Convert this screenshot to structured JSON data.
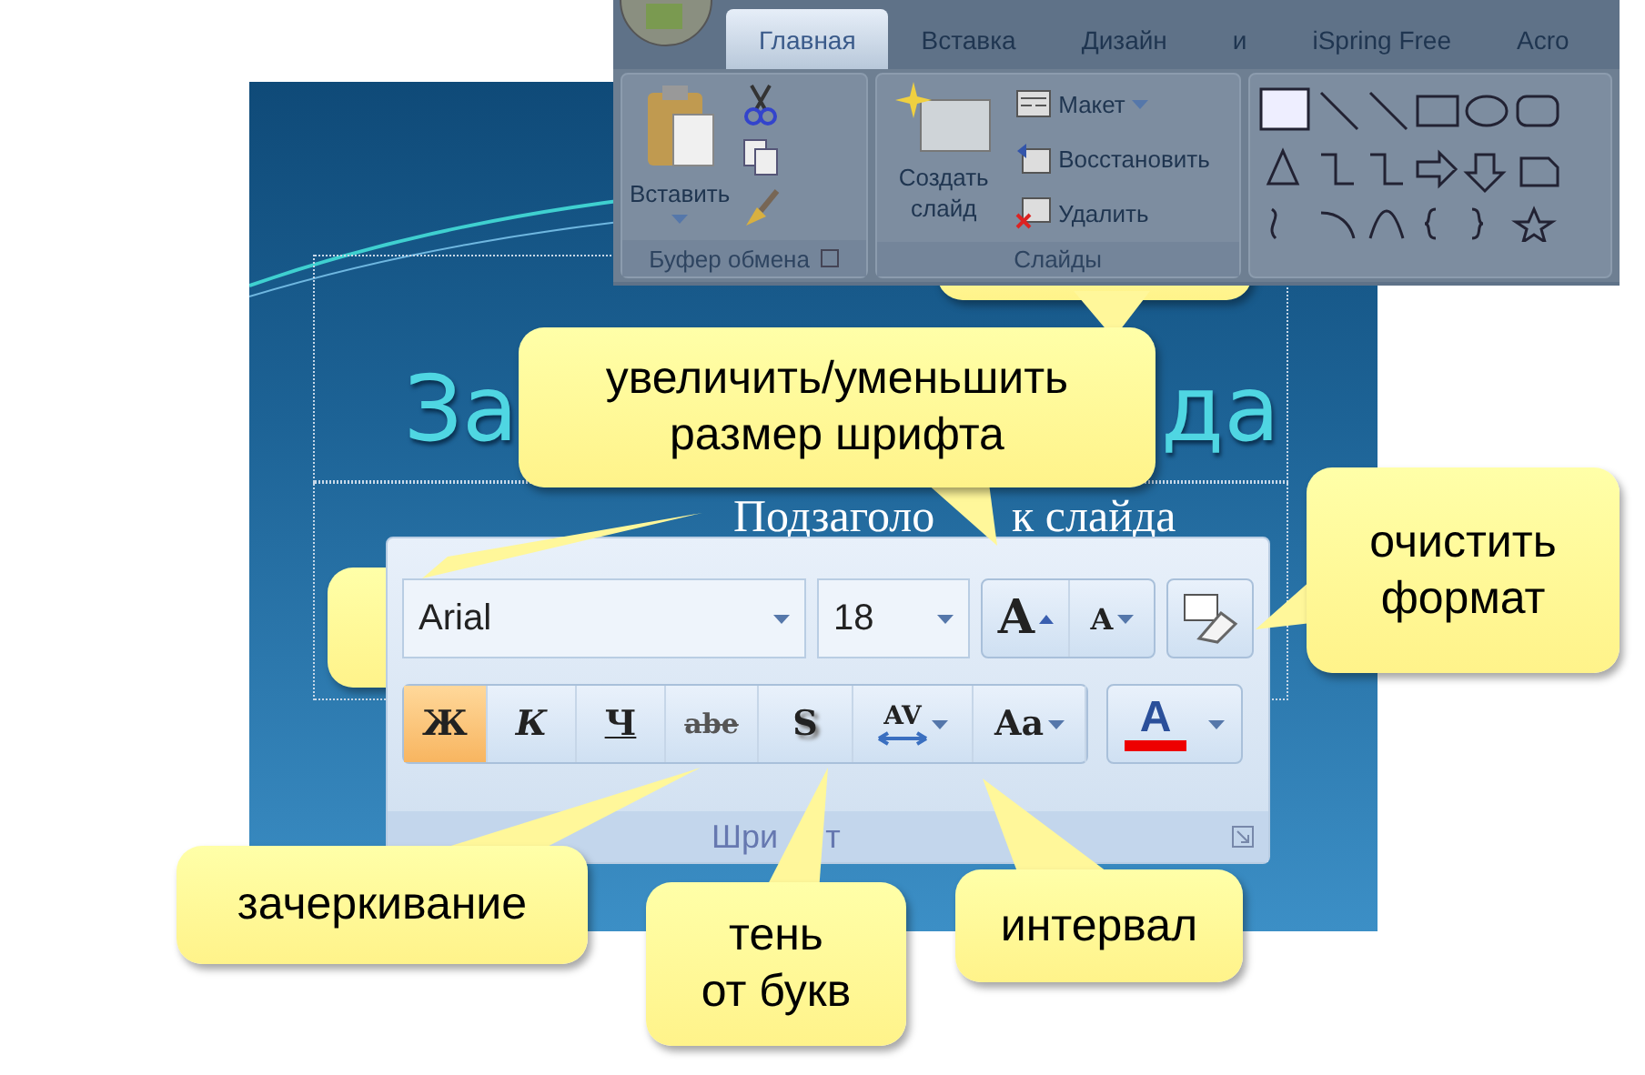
{
  "ribbon": {
    "tabs": [
      {
        "label": "Главная",
        "selected": true
      },
      {
        "label": "Вставка",
        "selected": false
      },
      {
        "label": "Дизайн",
        "selected": false
      },
      {
        "label": "и",
        "selected": false
      },
      {
        "label": "iSpring Free",
        "selected": false
      },
      {
        "label": "Acro",
        "selected": false
      }
    ],
    "clipboard": {
      "paste": "Вставить",
      "label": "Буфер обмена"
    },
    "slides": {
      "new_slide": "Создать слайд",
      "layout": "Макет",
      "reset": "Восстановить",
      "delete": "Удалить",
      "label": "Слайды"
    }
  },
  "slide": {
    "title_parts": [
      "За",
      "да"
    ],
    "subtitle_parts": [
      "Подзаголо",
      "к слайда"
    ]
  },
  "font_panel": {
    "font": "Arial",
    "size": "18",
    "grow": "A",
    "shrink": "A",
    "format_buttons": [
      {
        "kind": "bold",
        "label": "Ж",
        "selected": true
      },
      {
        "kind": "italic",
        "label": "К",
        "selected": false
      },
      {
        "kind": "underline",
        "label": "Ч",
        "selected": false
      },
      {
        "kind": "strike",
        "label": "abe",
        "selected": false
      },
      {
        "kind": "shadow",
        "label": "S",
        "selected": false
      },
      {
        "kind": "spacing",
        "label": "AV",
        "selected": false
      },
      {
        "kind": "case",
        "label": "Aa",
        "selected": false
      },
      {
        "kind": "color",
        "label": "A",
        "selected": false
      }
    ],
    "group_label_parts": [
      "Шри",
      "т"
    ]
  },
  "callouts": [
    {
      "text": "увеличить/уменьшить размер шрифта"
    },
    {
      "text": "очистить формат"
    },
    {
      "text": "зачеркивание"
    },
    {
      "text": "тень\nот букв"
    },
    {
      "text": "интервал"
    }
  ]
}
